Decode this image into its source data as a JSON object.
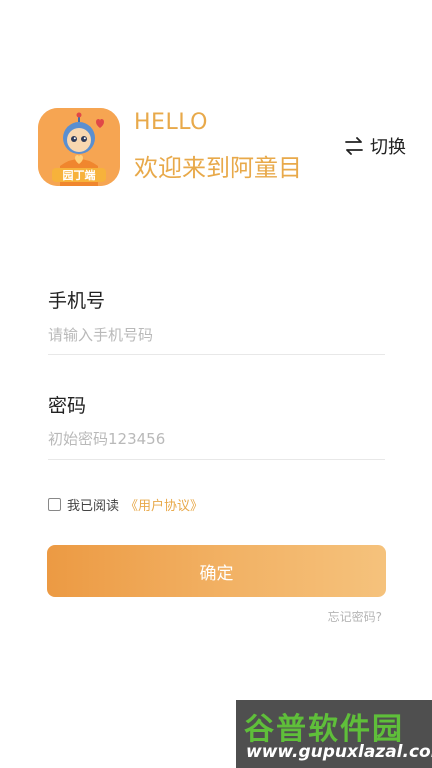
{
  "header": {
    "logo_text": "园丁端",
    "greeting": "HELLO",
    "welcome": "欢迎来到阿童目",
    "switch_label": "切换"
  },
  "form": {
    "phone": {
      "label": "手机号",
      "placeholder": "请输入手机号码",
      "value": ""
    },
    "password": {
      "label": "密码",
      "placeholder": "初始密码123456",
      "value": ""
    },
    "agreement": {
      "checked": false,
      "text": "我已阅读",
      "link": "《用户协议》"
    },
    "confirm_label": "确定",
    "forgot_label": "忘记密码?"
  },
  "watermark": {
    "title": "谷普软件园",
    "url": "www.gupuxlazal.com"
  },
  "colors": {
    "accent": "#e8a94a",
    "button_start": "#ec9a43",
    "button_end": "#f5c27c"
  }
}
